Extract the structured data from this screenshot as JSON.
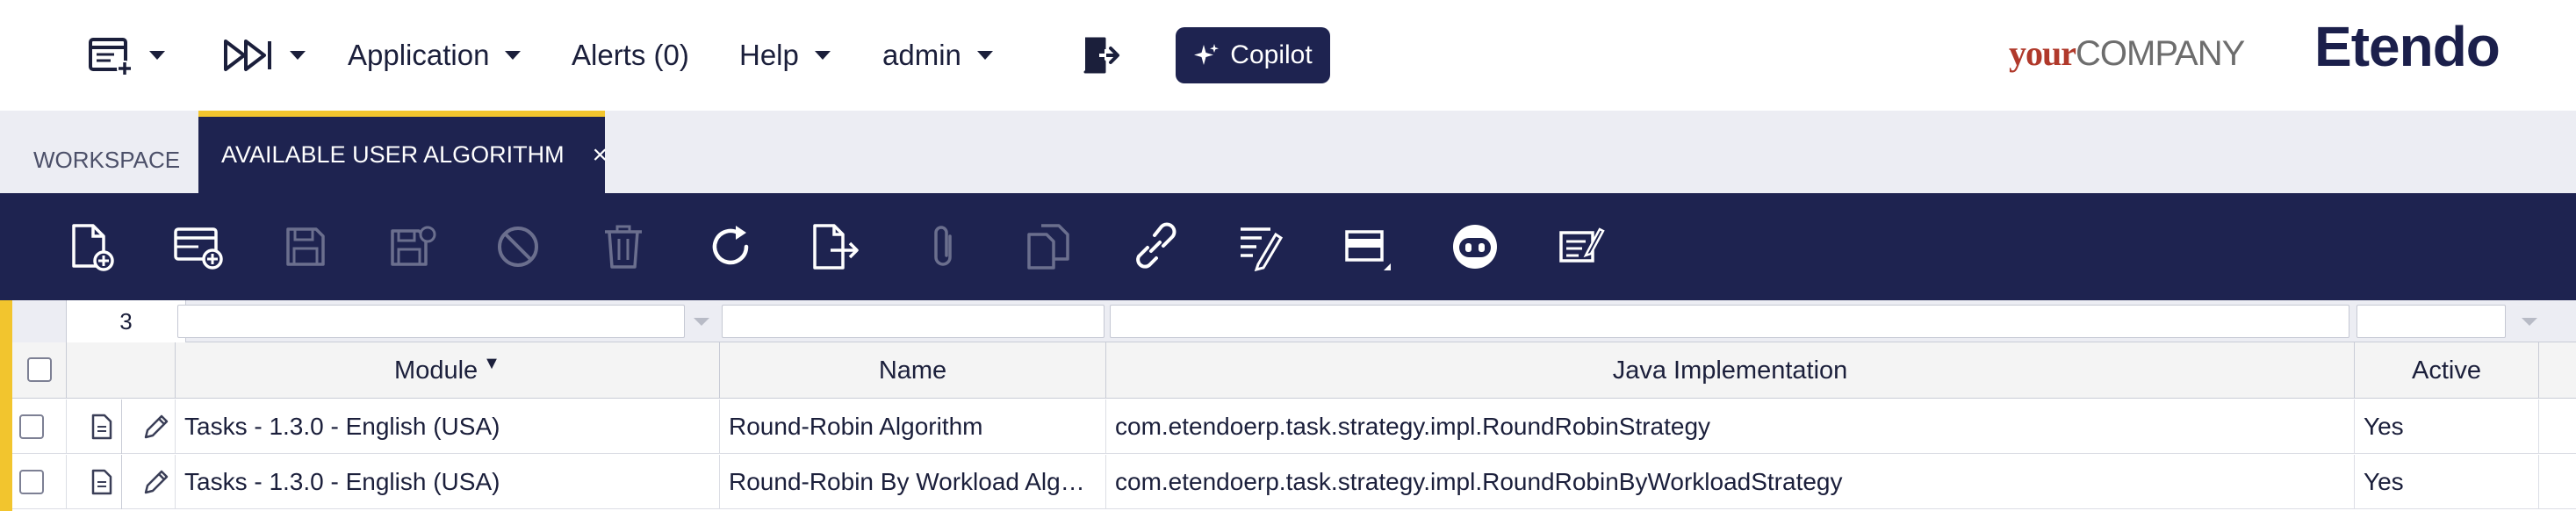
{
  "nav": {
    "application_label": "Application",
    "alerts_label": "Alerts (0)",
    "help_label": "Help",
    "user_label": "admin",
    "copilot_label": "Copilot"
  },
  "brand": {
    "company_your": "your",
    "company_name": "COMPANY",
    "product": "Etendo"
  },
  "tabs": [
    {
      "label": "WORKSPACE"
    },
    {
      "label": "AVAILABLE USER ALGORITHM",
      "close": "×"
    }
  ],
  "toolbar": {
    "icons": [
      "new-document-icon",
      "new-row-icon",
      "save-icon",
      "save-close-icon",
      "cancel-icon",
      "delete-icon",
      "refresh-icon",
      "export-icon",
      "attachment-icon",
      "copy-record-icon",
      "link-icon",
      "audit-trail-icon",
      "toggle-form-view-icon",
      "copilot-bot-icon",
      "notes-icon"
    ],
    "disabled": [
      "save-icon",
      "save-close-icon",
      "cancel-icon",
      "delete-icon",
      "attachment-icon",
      "copy-record-icon"
    ]
  },
  "grid": {
    "record_count": "3",
    "columns": [
      "Module",
      "Name",
      "Java Implementation",
      "Active"
    ],
    "sorted_column": "Module",
    "sort_indicator": "▼",
    "rows": [
      [
        "Tasks - 1.3.0 - English (USA)",
        "Round-Robin Algorithm",
        "com.etendoerp.task.strategy.impl.RoundRobinStrategy",
        "Yes"
      ],
      [
        "Tasks - 1.3.0 - English (USA)",
        "Round-Robin By Workload Alg…",
        "com.etendoerp.task.strategy.impl.RoundRobinByWorkloadStrategy",
        "Yes"
      ]
    ]
  },
  "colors": {
    "navy": "#1e2350",
    "accent_yellow": "#f2c52e",
    "brand_red": "#b0392b",
    "tab_bg": "#ecedf3"
  }
}
